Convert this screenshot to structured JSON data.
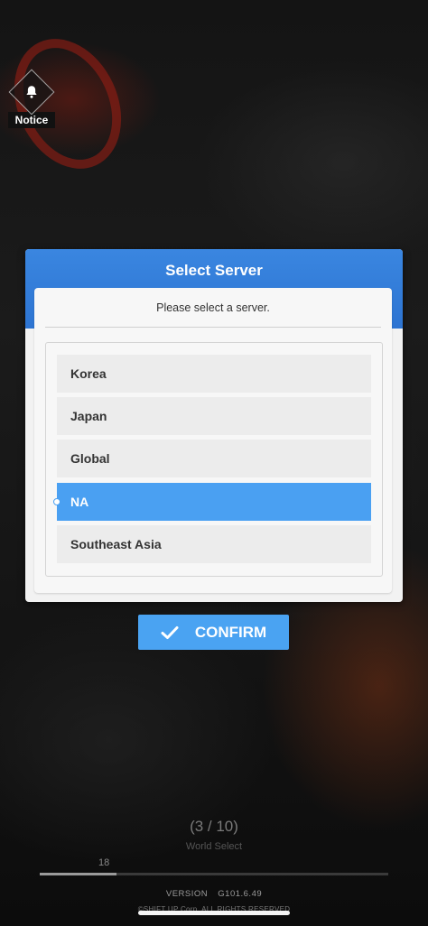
{
  "notice": {
    "label": "Notice",
    "icon": "bell-icon"
  },
  "dialog": {
    "title": "Select Server",
    "prompt": "Please select a server.",
    "servers": [
      {
        "label": "Korea",
        "selected": false
      },
      {
        "label": "Japan",
        "selected": false
      },
      {
        "label": "Global",
        "selected": false
      },
      {
        "label": "NA",
        "selected": true
      },
      {
        "label": "Southeast Asia",
        "selected": false
      }
    ],
    "confirm_label": "CONFIRM",
    "confirm_icon": "checkmark-icon",
    "accent": "#4aa3f2"
  },
  "footer": {
    "counter": "(3 / 10)",
    "step_label": "World Select",
    "progress_value": "18",
    "version_label": "VERSION",
    "version_number": "G101.6.49",
    "copyright": "©SHIFT UP Corp. ALL RIGHTS RESERVED"
  }
}
